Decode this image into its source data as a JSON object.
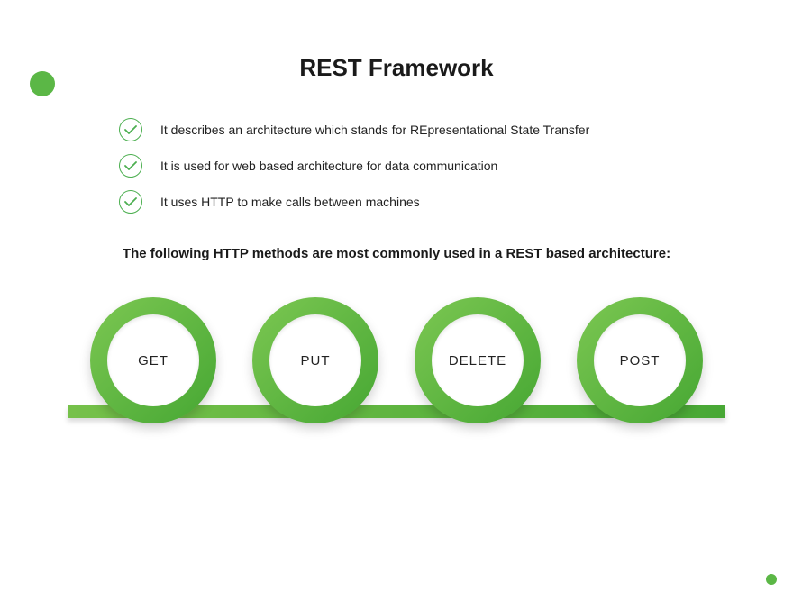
{
  "title": "REST Framework",
  "bullets": [
    "It describes an architecture which stands for REpresentational State Transfer",
    "It is used for web based architecture for data communication",
    "It uses HTTP to make calls between machines"
  ],
  "subheading": "The following HTTP methods are most commonly used in a REST based architecture:",
  "methods": [
    "GET",
    "PUT",
    "DELETE",
    "POST"
  ],
  "colors": {
    "accent": "#5bb746",
    "ringStart": "#7cc752",
    "ringEnd": "#46a733"
  }
}
